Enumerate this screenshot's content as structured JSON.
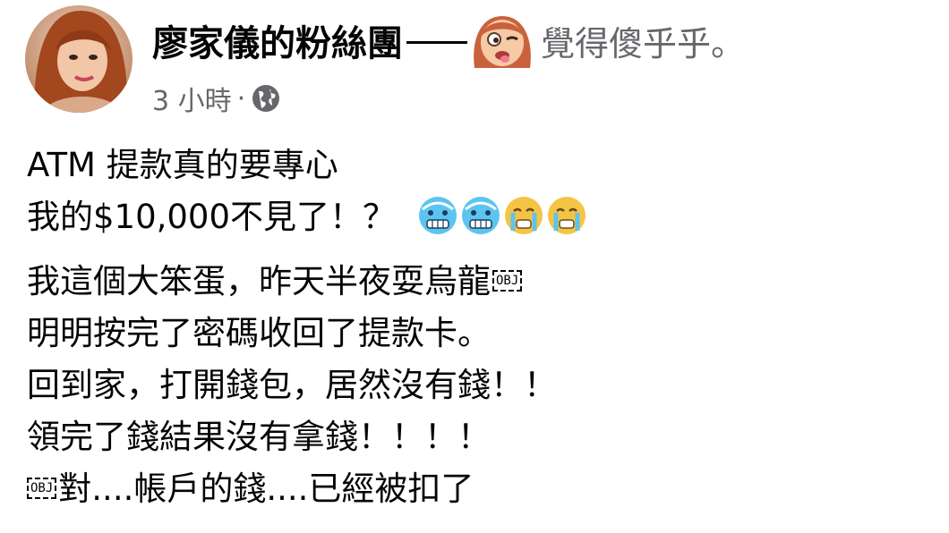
{
  "post": {
    "author_name": "廖家儀的粉絲團",
    "feeling_text": "覺得傻乎乎。",
    "feeling_icon": "silly-face-icon",
    "time": "3 小時",
    "separator": "·",
    "audience_icon": "globe-icon",
    "lines": {
      "l1": "ATM 提款真的要專心",
      "l2": "我的$10,000不見了！？",
      "l3": "我這個大笨蛋，昨天半夜耍烏龍",
      "l4": "明明按完了密碼收回了提款卡。",
      "l5": "回到家，打開錢包，居然沒有錢！！",
      "l6": "領完了錢結果沒有拿錢！！！！",
      "l7": "對....帳戶的錢....已經被扣了"
    },
    "obj_placeholder": "OBJ",
    "emojis": [
      "cold-face-icon",
      "cold-face-icon",
      "crying-face-icon",
      "crying-face-icon"
    ]
  },
  "colors": {
    "text": "#050505",
    "secondary_text": "#65676b",
    "cold_face": "#5cc4f0",
    "crying_face": "#f6c445"
  }
}
